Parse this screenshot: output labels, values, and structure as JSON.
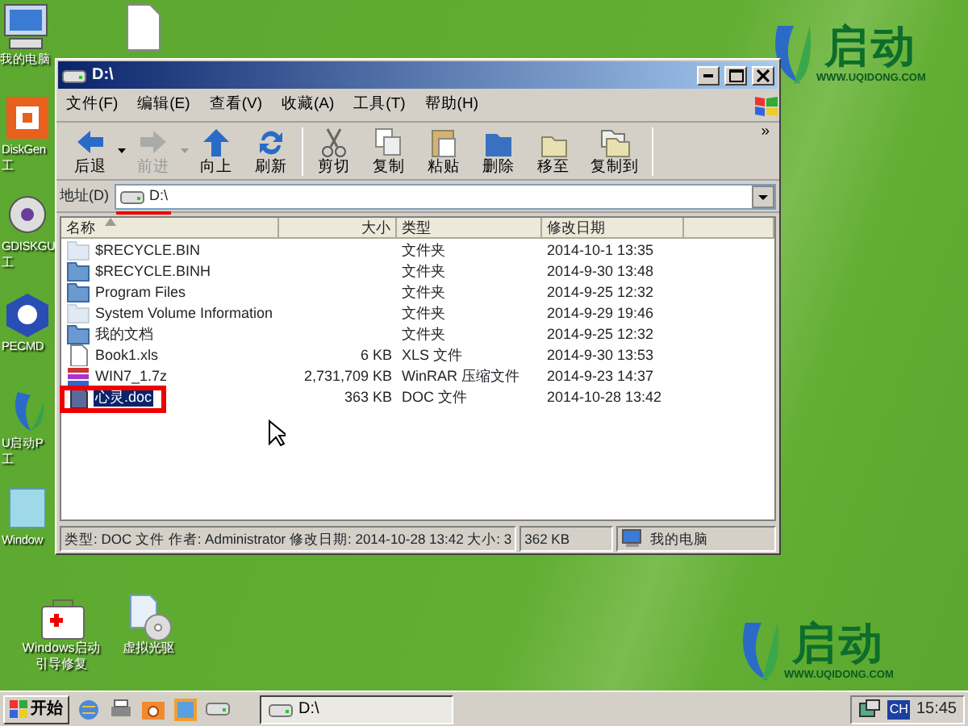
{
  "desktop_icons": [
    {
      "kind": "computer",
      "lines": [
        "我的电脑"
      ]
    },
    {
      "kind": "document"
    },
    {
      "kind": "diskgenius",
      "lines": [
        "DiskGen",
        "工"
      ]
    },
    {
      "kind": "gdisk",
      "lines": [
        "GDISKGU",
        "工"
      ]
    },
    {
      "kind": "pecmd",
      "lines": [
        "PECMD"
      ]
    },
    {
      "kind": "uqidong",
      "lines": [
        "U启动P",
        "工"
      ]
    },
    {
      "kind": "windows",
      "lines": [
        "Window"
      ]
    },
    {
      "kind": "toolbox",
      "lines": [
        "Windows启动",
        "引导修复"
      ]
    },
    {
      "kind": "virtual-drive",
      "lines": [
        "虚拟光驱"
      ]
    }
  ],
  "logos": [
    {
      "text": "启动",
      "url": "WWW.UQIDONG.COM"
    },
    {
      "text": "启动",
      "url": "WWW.UQIDONG.COM"
    }
  ],
  "window": {
    "title": "D:\\",
    "menu": [
      "文件(F)",
      "编辑(E)",
      "查看(V)",
      "收藏(A)",
      "工具(T)",
      "帮助(H)"
    ],
    "toolbar_groups": [
      [
        {
          "label": "后退",
          "disabled": false,
          "dropdown": true
        },
        {
          "label": "前进",
          "disabled": true,
          "dropdown": true
        },
        {
          "label": "向上",
          "disabled": false,
          "dropdown": false
        },
        {
          "label": "刷新",
          "disabled": false,
          "dropdown": false
        }
      ],
      [
        {
          "label": "剪切",
          "disabled": false,
          "dropdown": false
        },
        {
          "label": "复制",
          "disabled": false,
          "dropdown": false
        },
        {
          "label": "粘贴",
          "disabled": false,
          "dropdown": false
        },
        {
          "label": "删除",
          "disabled": false,
          "dropdown": false
        },
        {
          "label": "移至",
          "disabled": false,
          "dropdown": false
        },
        {
          "label": "复制到",
          "disabled": false,
          "dropdown": false
        }
      ]
    ],
    "toolbar_more": "»",
    "address": {
      "label": "地址(D)",
      "value": "D:\\",
      "marked": true
    },
    "columns": [
      {
        "label": "名称",
        "sorted": true
      },
      {
        "label": "大小",
        "sorted": false
      },
      {
        "label": "类型",
        "sorted": false
      },
      {
        "label": "修改日期",
        "sorted": false
      }
    ],
    "rows": [
      {
        "kind": "folder",
        "hidden": true,
        "name": "$RECYCLE.BIN",
        "type": "文件夹",
        "modified": "2014-10-1 13:35",
        "selected": false,
        "marked": false
      },
      {
        "kind": "folder",
        "hidden": false,
        "name": "$RECYCLE.BINH",
        "type": "文件夹",
        "modified": "2014-9-30 13:48",
        "selected": false,
        "marked": false
      },
      {
        "kind": "folder",
        "hidden": false,
        "name": "Program Files",
        "type": "文件夹",
        "modified": "2014-9-25 12:32",
        "selected": false,
        "marked": false
      },
      {
        "kind": "folder",
        "hidden": true,
        "name": "System Volume Information",
        "type": "文件夹",
        "modified": "2014-9-29 19:46",
        "selected": false,
        "marked": false
      },
      {
        "kind": "folder",
        "hidden": false,
        "name": "我的文档",
        "type": "文件夹",
        "modified": "2014-9-25 12:32",
        "selected": false,
        "marked": false
      },
      {
        "kind": "file",
        "hidden": false,
        "name": "Book1.xls",
        "size": "6 KB",
        "type": "XLS 文件",
        "modified": "2014-9-30 13:53",
        "selected": false,
        "marked": false
      },
      {
        "kind": "archive",
        "hidden": false,
        "name": "WIN7_1.7z",
        "size": "2,731,709 KB",
        "type": "WinRAR 压缩文件",
        "modified": "2014-9-23 14:37",
        "selected": false,
        "marked": false
      },
      {
        "kind": "document",
        "hidden": false,
        "name": "心灵.doc",
        "size": "363 KB",
        "type": "DOC 文件",
        "modified": "2014-10-28 13:42",
        "selected": true,
        "marked": true
      }
    ],
    "status": [
      "类型: DOC 文件 作者: Administrator 修改日期: 2014-10-28 13:42 大小: 3",
      "362 KB"
    ],
    "status_zone": "我的电脑"
  },
  "taskbar": {
    "start": "开始",
    "tasks": [
      {
        "label": "D:\\",
        "selected": false
      }
    ],
    "language": "CH",
    "clock": "15:45"
  }
}
